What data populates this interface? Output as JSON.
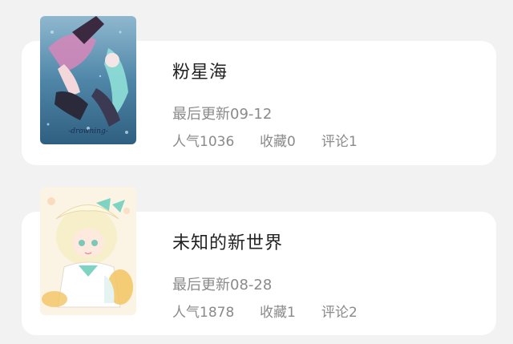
{
  "works": [
    {
      "cover_caption": "-drowning-",
      "title": "粉星海",
      "updated": "最后更新09-12",
      "popularity": "人气1036",
      "favorites": "收藏0",
      "comments": "评论1"
    },
    {
      "title": "未知的新世界",
      "updated": "最后更新08-28",
      "popularity": "人气1878",
      "favorites": "收藏1",
      "comments": "评论2"
    }
  ],
  "colors": {
    "background": "#f2f2f2",
    "card": "#ffffff",
    "title_text": "#222222",
    "meta_text": "#8a8a8a"
  }
}
